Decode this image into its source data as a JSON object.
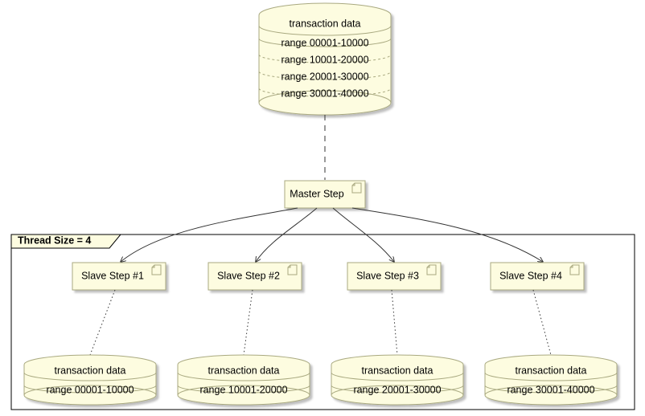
{
  "top_db": {
    "title": "transaction data",
    "rows": [
      "range 00001-10000",
      "range 10001-20000",
      "range 20001-30000",
      "range 30001-40000"
    ]
  },
  "master": {
    "label": "Master Step"
  },
  "frame": {
    "title": "Thread Size = 4"
  },
  "slaves": [
    {
      "label": "Slave Step #1",
      "db_title": "transaction data",
      "db_range": "range 00001-10000"
    },
    {
      "label": "Slave Step #2",
      "db_title": "transaction data",
      "db_range": "range 10001-20000"
    },
    {
      "label": "Slave Step #3",
      "db_title": "transaction data",
      "db_range": "range 20001-30000"
    },
    {
      "label": "Slave Step #4",
      "db_title": "transaction data",
      "db_range": "range 30001-40000"
    }
  ]
}
